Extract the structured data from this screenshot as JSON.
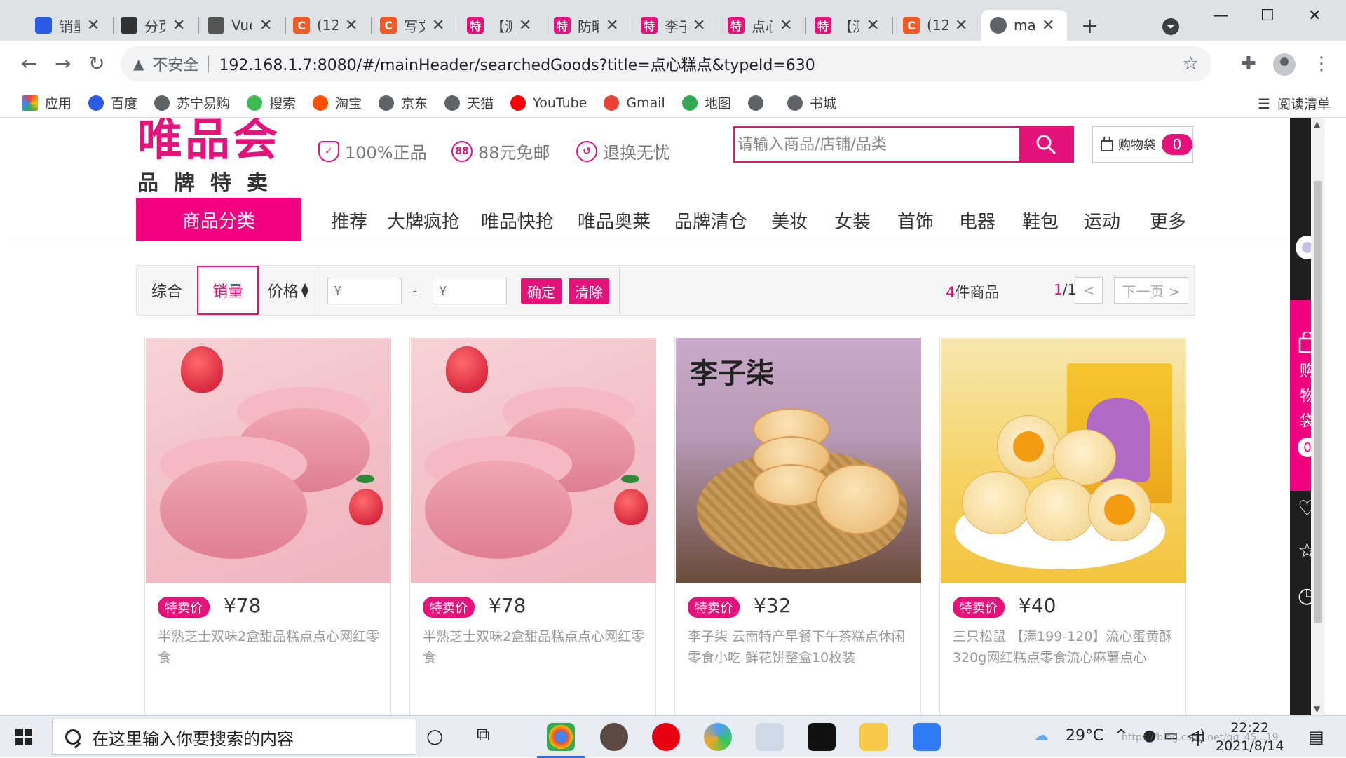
{
  "browser": {
    "tabs": [
      {
        "title": "销量",
        "icon": "baidu-paw-icon",
        "color": "#2b5ce6"
      },
      {
        "title": "分页",
        "icon": "bird-icon",
        "color": "#333333"
      },
      {
        "title": "Vue",
        "icon": "vue-icon",
        "color": "#555555"
      },
      {
        "title": "(12",
        "icon": "csdn-c-icon",
        "color": "#f15a24"
      },
      {
        "title": "写文",
        "icon": "csdn-c-icon",
        "color": "#f15a24"
      },
      {
        "title": "【测",
        "icon": "te-icon",
        "color": "#e4137b"
      },
      {
        "title": "防晒",
        "icon": "te-icon",
        "color": "#e4137b"
      },
      {
        "title": "李子",
        "icon": "te-icon",
        "color": "#e4137b"
      },
      {
        "title": "点心",
        "icon": "te-icon",
        "color": "#e4137b"
      },
      {
        "title": "【测",
        "icon": "te-icon",
        "color": "#e4137b"
      },
      {
        "title": "(12",
        "icon": "csdn-c-icon",
        "color": "#f15a24"
      },
      {
        "title": "ma",
        "icon": "globe-icon",
        "color": "#5f6368",
        "active": true
      }
    ],
    "insecure_label": "不安全",
    "url": "192.168.1.7:8080/#/mainHeader/searchedGoods?title=点心糕点&typeId=630",
    "bookmarks": [
      {
        "label": "应用",
        "icon": "apps-grid-icon",
        "color": "#e94235"
      },
      {
        "label": "百度",
        "icon": "baidu-paw-icon",
        "color": "#2b5ce6"
      },
      {
        "label": "苏宁易购",
        "icon": "globe-icon",
        "color": "#5f6368"
      },
      {
        "label": "搜索",
        "icon": "search-o-icon",
        "color": "#3cba54"
      },
      {
        "label": "淘宝",
        "icon": "taobao-icon",
        "color": "#ff5000"
      },
      {
        "label": "京东",
        "icon": "globe-icon",
        "color": "#5f6368"
      },
      {
        "label": "天猫",
        "icon": "globe-icon",
        "color": "#5f6368"
      },
      {
        "label": "YouTube",
        "icon": "youtube-icon",
        "color": "#ff0000"
      },
      {
        "label": "Gmail",
        "icon": "gmail-icon",
        "color": "#ea4335"
      },
      {
        "label": "地图",
        "icon": "maps-icon",
        "color": "#34a853"
      },
      {
        "label": "",
        "icon": "globe-icon",
        "color": "#5f6368"
      },
      {
        "label": "书城",
        "icon": "globe-icon",
        "color": "#5f6368"
      }
    ],
    "reading_list": "阅读清单"
  },
  "header": {
    "logo_main": "唯品会",
    "logo_sub": "品牌特卖",
    "promises": [
      {
        "label": "100%正品",
        "icon": "shield-check-icon"
      },
      {
        "label": "88元免邮",
        "icon": "badge-88-icon",
        "badge": "88"
      },
      {
        "label": "退换无忧",
        "icon": "return-arrow-icon"
      }
    ],
    "search_placeholder": "请输入商品/店铺/品类",
    "bag_label": "购物袋",
    "bag_count": "0"
  },
  "nav": {
    "category_button": "商品分类",
    "items": [
      "推荐",
      "大牌疯抢",
      "唯品快抢",
      "唯品奥莱",
      "品牌清仓",
      "美妆",
      "女装",
      "首饰",
      "电器",
      "鞋包",
      "运动",
      "更多"
    ]
  },
  "filter": {
    "sort_options": [
      "综合",
      "销量",
      "价格"
    ],
    "active_sort": "销量",
    "price_min_placeholder": "¥",
    "price_max_placeholder": "¥",
    "price_dash": "-",
    "confirm": "确定",
    "clear": "清除",
    "count_number": "4",
    "count_suffix": "件商品",
    "page_current": "1",
    "page_total": "/1",
    "prev": "<",
    "next": "下一页 >"
  },
  "products": [
    {
      "tag": "特卖价",
      "price": "¥78",
      "name": "半熟芝士双味2盒甜品糕点点心网红零食",
      "image": "strawberry-cheesecake"
    },
    {
      "tag": "特卖价",
      "price": "¥78",
      "name": "半熟芝士双味2盒甜品糕点点心网红零食",
      "image": "strawberry-cheesecake"
    },
    {
      "tag": "特卖价",
      "price": "¥32",
      "name": "李子柒 云南特产早餐下午茶糕点休闲零食小吃 鲜花饼整盒10枚装",
      "image": "flower-cakes",
      "image_text": "李子柒"
    },
    {
      "tag": "特卖价",
      "price": "¥40",
      "name": "三只松鼠 【满199-120】流心蛋黄酥320g网红糕点零食流心麻薯点心",
      "image": "egg-yolk-pastry"
    }
  ],
  "sidebar": {
    "bag_label": [
      "购",
      "物",
      "袋"
    ],
    "bag_count": "0"
  },
  "taskbar": {
    "search_placeholder": "在这里输入你要搜索的内容",
    "weather": "29°C",
    "ime": "中",
    "time": "22:22",
    "date": "2021/8/14",
    "watermark": "https://blog.csdn.net/qq_45...19"
  },
  "colors": {
    "brand": "#e4137b",
    "category_bg": "#f10180"
  }
}
